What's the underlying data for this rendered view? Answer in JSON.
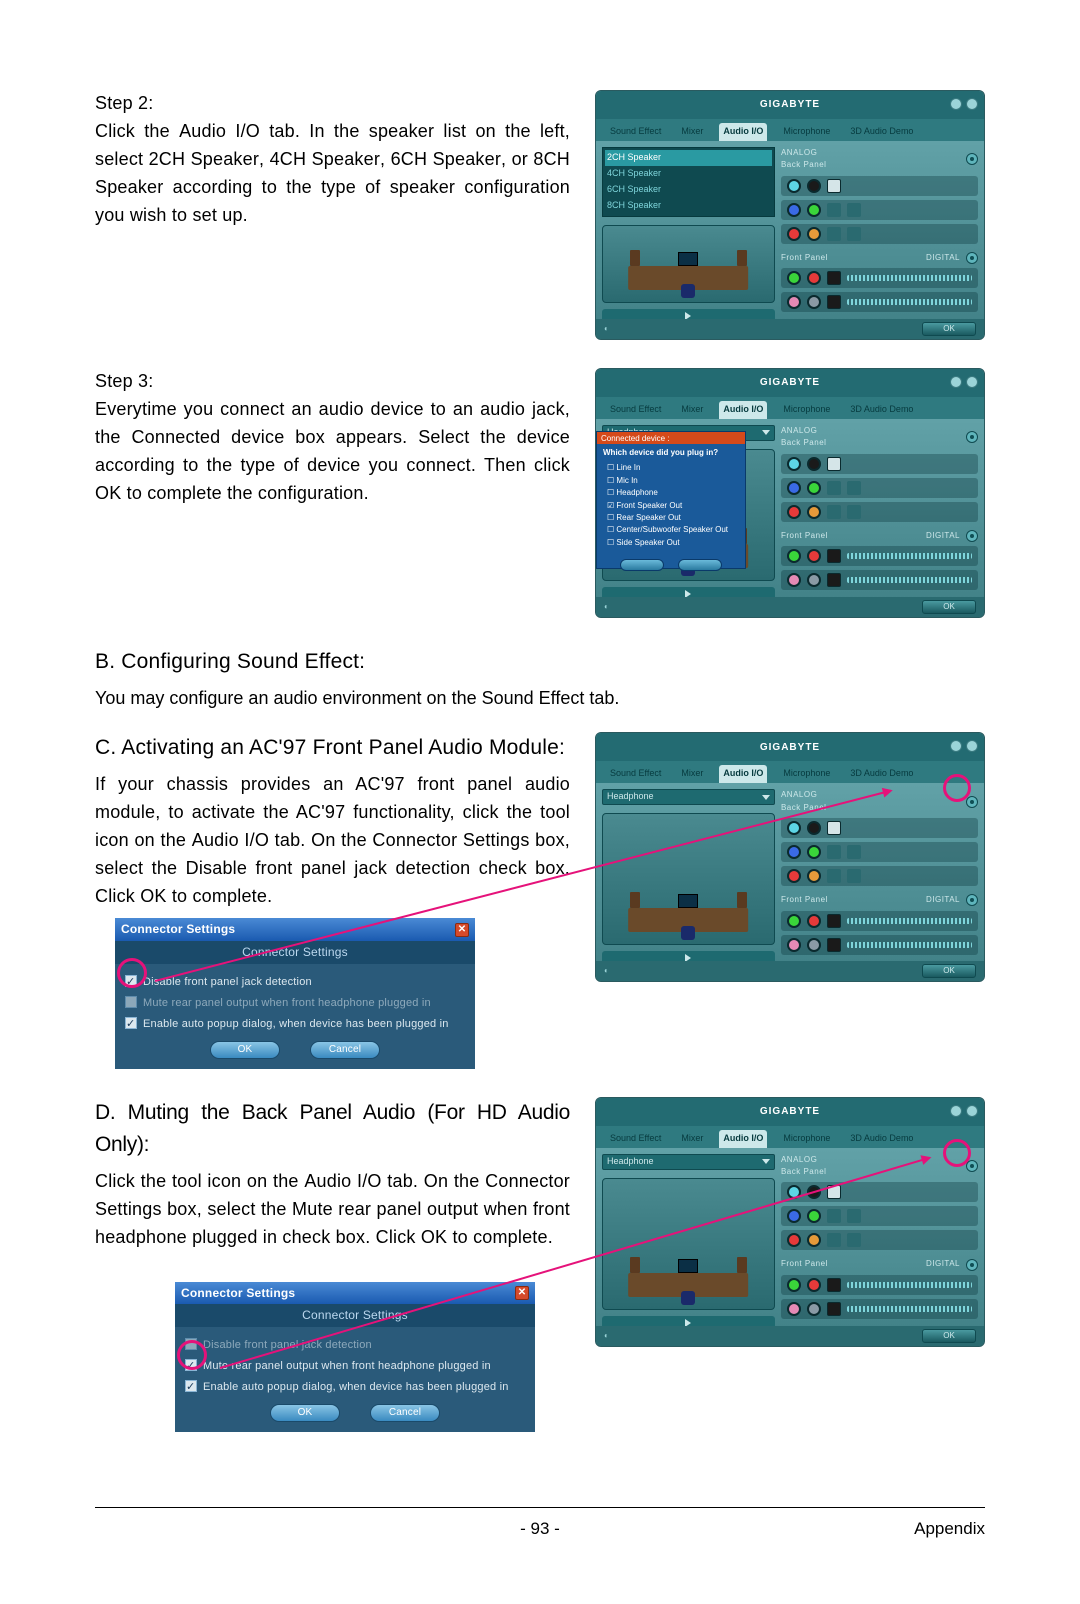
{
  "steps": {
    "s2": {
      "label": "Step 2:",
      "body_1": "Click the ",
      "body_2": "Audio I/O",
      "body_3": " tab. In the speaker list on the left, select ",
      "body_4": "2CH Speaker",
      "body_5": ", ",
      "body_6": "4CH Speaker",
      "body_7": ", ",
      "body_8": "6CH Speaker",
      "body_9": ", or ",
      "body_10": "8CH Speaker",
      "body_11": " according to the type of speaker configuration you wish to set up."
    },
    "s3": {
      "label": "Step 3:",
      "body_1": "Everytime you connect an audio device to an audio jack, the ",
      "body_2": "Connected device",
      "body_3": " box appears. Select the device according to the type of device you connect. Then click ",
      "body_4": "OK",
      "body_5": " to complete the configuration."
    }
  },
  "sectionB": {
    "title": "B. Configuring Sound Effect:",
    "body_1": "You may configure an audio environment on the ",
    "body_2": "Sound Effect",
    "body_3": " tab."
  },
  "sectionC": {
    "title": "C. Activating an AC'97 Front Panel Audio Module:",
    "body_1": "If your chassis provides an AC'97 front panel audio module, to activate the AC'97 functionality, click the tool icon on the ",
    "body_2": "Audio I/O",
    "body_3": " tab. On the ",
    "body_4": "Connector Settings",
    "body_5": " box, select the ",
    "body_6": "Disable front panel jack detection",
    "body_7": " check box. Click ",
    "body_8": "OK",
    "body_9": " to complete."
  },
  "sectionD": {
    "title": "D. Muting the Back Panel Audio (For HD Audio Only):",
    "body_1": "Click the tool icon on the ",
    "body_2": "Audio I/O",
    "body_3": " tab. On the ",
    "body_4": "Connector Settings",
    "body_5": " box, select the ",
    "body_6": "Mute rear panel output when front headphone plugged in",
    "body_7": " check box. Click ",
    "body_8": "OK",
    "body_9": " to complete."
  },
  "panel": {
    "brand": "GIGABYTE",
    "tabs": [
      "Sound Effect",
      "Mixer",
      "Audio I/O",
      "Microphone",
      "3D Audio Demo"
    ],
    "active_tab": "Audio I/O",
    "dropdown": "Headphone",
    "analog_label": "ANALOG",
    "back_panel_label": "Back Panel",
    "front_panel_label": "Front Panel",
    "digital_label": "DIGITAL",
    "ok": "OK",
    "speaker_options": [
      "2CH Speaker",
      "4CH Speaker",
      "6CH Speaker",
      "8CH Speaker"
    ]
  },
  "popup": {
    "bar": "Connected device :",
    "question": "Which device did you plug in?",
    "options": [
      "Line In",
      "Mic In",
      "Headphone",
      "Front Speaker Out",
      "Rear Speaker Out",
      "Center/Subwoofer Speaker Out",
      "Side Speaker Out"
    ],
    "checked_index": 3
  },
  "connector": {
    "title": "Connector Settings",
    "subtitle": "Connector Settings",
    "opt_disable": "Disable front panel jack detection",
    "opt_mute": "Mute rear panel output when front headphone plugged in",
    "opt_auto": "Enable auto popup dialog, when device has been plugged in",
    "ok": "OK",
    "cancel": "Cancel"
  },
  "footer": {
    "page": "- 93 -",
    "section": "Appendix"
  }
}
